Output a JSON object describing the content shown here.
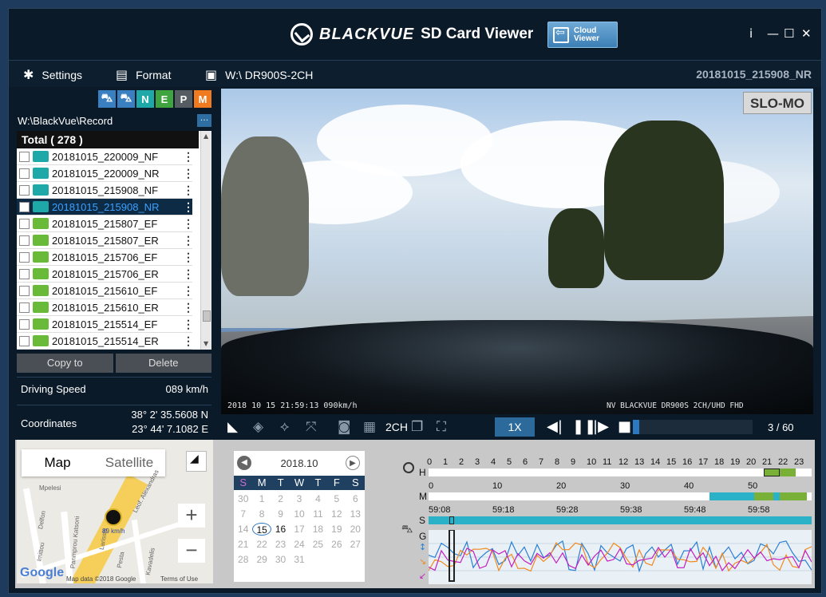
{
  "app": {
    "brand": "BLACKVUE",
    "product": "SD Card Viewer",
    "cloud_label": "Cloud\nViewer",
    "controls": {
      "info": "i",
      "minimize": "—",
      "maximize": "☐",
      "close": "✕"
    }
  },
  "menu": {
    "settings": "Settings",
    "format": "Format",
    "drive": "W:\\ DR900S-2CH",
    "current_file": "20181015_215908_NR"
  },
  "filters": [
    {
      "label": "",
      "color": "#3a7fc0",
      "icon": "car-front-icon"
    },
    {
      "label": "",
      "color": "#3a7fc0",
      "icon": "car-rear-icon"
    },
    {
      "label": "N",
      "color": "#1fa8a8",
      "icon": "normal-icon"
    },
    {
      "label": "E",
      "color": "#3fa43f",
      "icon": "event-icon"
    },
    {
      "label": "P",
      "color": "#555c62",
      "icon": "parking-icon"
    },
    {
      "label": "M",
      "color": "#f07a20",
      "icon": "manual-icon"
    }
  ],
  "file_list": {
    "path": "W:\\BlackVue\\Record",
    "more": "…",
    "total": "Total ( 278 )",
    "items": [
      {
        "name": "20181015_220009_NF",
        "color": "#1fa8a8",
        "selected": false
      },
      {
        "name": "20181015_220009_NR",
        "color": "#1fa8a8",
        "selected": false
      },
      {
        "name": "20181015_215908_NF",
        "color": "#1fa8a8",
        "selected": false
      },
      {
        "name": "20181015_215908_NR",
        "color": "#1fa8a8",
        "selected": true
      },
      {
        "name": "20181015_215807_EF",
        "color": "#6aba3a",
        "selected": false
      },
      {
        "name": "20181015_215807_ER",
        "color": "#6aba3a",
        "selected": false
      },
      {
        "name": "20181015_215706_EF",
        "color": "#6aba3a",
        "selected": false
      },
      {
        "name": "20181015_215706_ER",
        "color": "#6aba3a",
        "selected": false
      },
      {
        "name": "20181015_215610_EF",
        "color": "#6aba3a",
        "selected": false
      },
      {
        "name": "20181015_215610_ER",
        "color": "#6aba3a",
        "selected": false
      },
      {
        "name": "20181015_215514_EF",
        "color": "#6aba3a",
        "selected": false
      },
      {
        "name": "20181015_215514_ER",
        "color": "#6aba3a",
        "selected": false
      }
    ],
    "copy_label": "Copy to",
    "delete_label": "Delete"
  },
  "telemetry": {
    "speed_label": "Driving Speed",
    "speed_value": "089 km/h",
    "coord_label": "Coordinates",
    "lat": "38° 2' 35.5608 N",
    "lon": "23° 44' 7.1082 E"
  },
  "video": {
    "slomo": "SLO-MO",
    "osd_left": "2018 10 15  21:59:13  090km/h",
    "osd_right": "NV  BLACKVUE DR900S 2CH/UHD FHD"
  },
  "player": {
    "channel_label": "2CH",
    "speed": "1X",
    "progress": 0.05,
    "frame_count": "3 / 60"
  },
  "map": {
    "tab_map": "Map",
    "tab_satellite": "Satellite",
    "zoom_in": "+",
    "zoom_out": "−",
    "google": "Google",
    "attribution": "Map data ©2018 Google",
    "terms": "Terms of Use",
    "marker_label": "89 km/h",
    "streets": [
      "Mpelesi",
      "Delfon",
      "Imittou",
      "Kavadelis",
      "Panmprou Katsoni",
      "Leof. Alexandras",
      "Pesta",
      "Larissis"
    ]
  },
  "calendar": {
    "title": "2018.10",
    "days": [
      "S",
      "M",
      "T",
      "W",
      "T",
      "F",
      "S"
    ],
    "cells": [
      {
        "d": "30",
        "a": false
      },
      {
        "d": "1",
        "a": false
      },
      {
        "d": "2",
        "a": false
      },
      {
        "d": "3",
        "a": false
      },
      {
        "d": "4",
        "a": false
      },
      {
        "d": "5",
        "a": false
      },
      {
        "d": "6",
        "a": false
      },
      {
        "d": "7",
        "a": false
      },
      {
        "d": "8",
        "a": false
      },
      {
        "d": "9",
        "a": false
      },
      {
        "d": "10",
        "a": false
      },
      {
        "d": "11",
        "a": false
      },
      {
        "d": "12",
        "a": false
      },
      {
        "d": "13",
        "a": false
      },
      {
        "d": "14",
        "a": false
      },
      {
        "d": "15",
        "a": true,
        "today": true
      },
      {
        "d": "16",
        "a": true
      },
      {
        "d": "17",
        "a": false
      },
      {
        "d": "18",
        "a": false
      },
      {
        "d": "19",
        "a": false
      },
      {
        "d": "20",
        "a": false
      },
      {
        "d": "21",
        "a": false
      },
      {
        "d": "22",
        "a": false
      },
      {
        "d": "23",
        "a": false
      },
      {
        "d": "24",
        "a": false
      },
      {
        "d": "25",
        "a": false
      },
      {
        "d": "26",
        "a": false
      },
      {
        "d": "27",
        "a": false
      },
      {
        "d": "28",
        "a": false
      },
      {
        "d": "29",
        "a": false
      },
      {
        "d": "30",
        "a": false
      },
      {
        "d": "31",
        "a": false
      }
    ]
  },
  "timeline": {
    "h_label": "H",
    "m_label": "M",
    "s_label": "S",
    "g_label": "G",
    "hours": [
      "0",
      "1",
      "2",
      "3",
      "4",
      "5",
      "6",
      "7",
      "8",
      "9",
      "10",
      "11",
      "12",
      "13",
      "14",
      "15",
      "16",
      "17",
      "18",
      "19",
      "20",
      "21",
      "22",
      "23"
    ],
    "minutes": [
      "0",
      "10",
      "20",
      "30",
      "40",
      "50"
    ],
    "seconds": [
      "59:08",
      "59:18",
      "59:28",
      "59:38",
      "59:48",
      "59:58"
    ]
  }
}
